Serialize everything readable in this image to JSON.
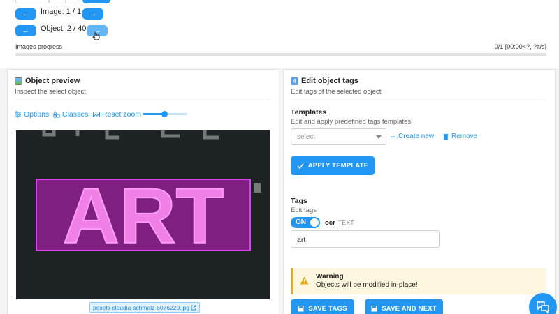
{
  "nav": {
    "prev_arrow": "←",
    "next_arrow": "→",
    "image_label": "Image: 1 / 1",
    "object_label": "Object: 2 / 40"
  },
  "progress": {
    "label": "Images progress",
    "value_text": "0/1 [00:00<?, ?it/s]",
    "fraction": 0.0
  },
  "preview_card": {
    "title": "Object preview",
    "subtitle": "Inspect the select object",
    "toolbar": {
      "options": "Options",
      "classes": "Classes",
      "reset_zoom": "Reset zoom",
      "zoom_level": 0.5
    },
    "image_text": "ART",
    "filename": "pexels-claudia-schmalz-6076229.jpg"
  },
  "tags_card": {
    "title": "Edit object tags",
    "subtitle": "Edit tags of the selected object",
    "templates": {
      "title": "Templates",
      "subtitle": "Edit and apply predefined tags templates",
      "select_placeholder": "select",
      "create_new": "Create new",
      "remove": "Remove",
      "apply_button": "APPLY TEMPLATE"
    },
    "tags": {
      "title": "Tags",
      "subtitle": "Edit tags",
      "toggle_label": "ON",
      "tag_name": "ocr",
      "tag_type": "TEXT",
      "value": "art"
    },
    "warning": {
      "title": "Warning",
      "text": "Objects will be modified in-place!"
    },
    "save_tags": "SAVE TAGS",
    "save_and_next": "SAVE AND NEXT"
  },
  "colors": {
    "accent": "#2196f3",
    "bbox": "#e040fb",
    "warning": "#e6a817"
  }
}
